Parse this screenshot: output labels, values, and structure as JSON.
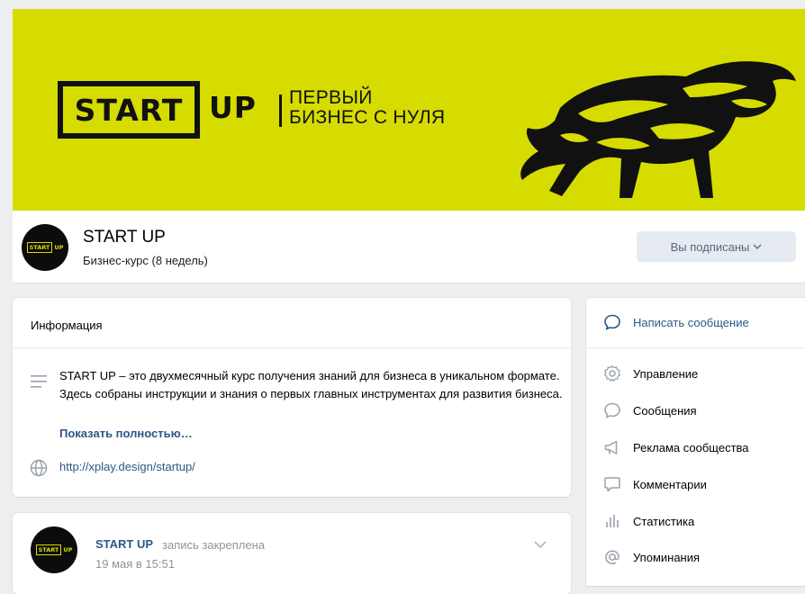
{
  "banner": {
    "logo_word": "START",
    "logo_up": "UP",
    "tagline_line1": "ПЕРВЫЙ",
    "tagline_line2": "БИЗНЕС С НУЛЯ",
    "background_color": "#d7dc00"
  },
  "group": {
    "name": "START UP",
    "status": "Бизнес-курс (8 недель)",
    "avatar_logo_word": "START",
    "avatar_logo_up": "UP",
    "subscribe_label": "Вы подписаны",
    "subscribe_chevron": "⌄"
  },
  "info": {
    "title": "Информация",
    "description": "START UP – это двухмесячный курс получения знаний для бизнеса в уникальном формате. Здесь собраны инструкции и знания о первых главных инструментах для развития бизнеса.",
    "show_more": "Показать полностью…",
    "url": "http://xplay.design/startup/"
  },
  "post": {
    "author": "START UP",
    "action": "запись закреплена",
    "date": "19 мая в 15:51"
  },
  "sidebar": {
    "items": [
      {
        "label": "Написать сообщение",
        "icon": "message-bubble-icon"
      },
      {
        "label": "Управление",
        "icon": "gear-icon"
      },
      {
        "label": "Сообщения",
        "icon": "chat-icon"
      },
      {
        "label": "Реклама сообщества",
        "icon": "megaphone-icon"
      },
      {
        "label": "Комментарии",
        "icon": "comment-icon"
      },
      {
        "label": "Статистика",
        "icon": "stats-icon"
      },
      {
        "label": "Упоминания",
        "icon": "at-icon"
      }
    ]
  },
  "colors": {
    "link": "#2a5885",
    "accent": "#d7dc00",
    "page_bg": "#edeef0"
  }
}
